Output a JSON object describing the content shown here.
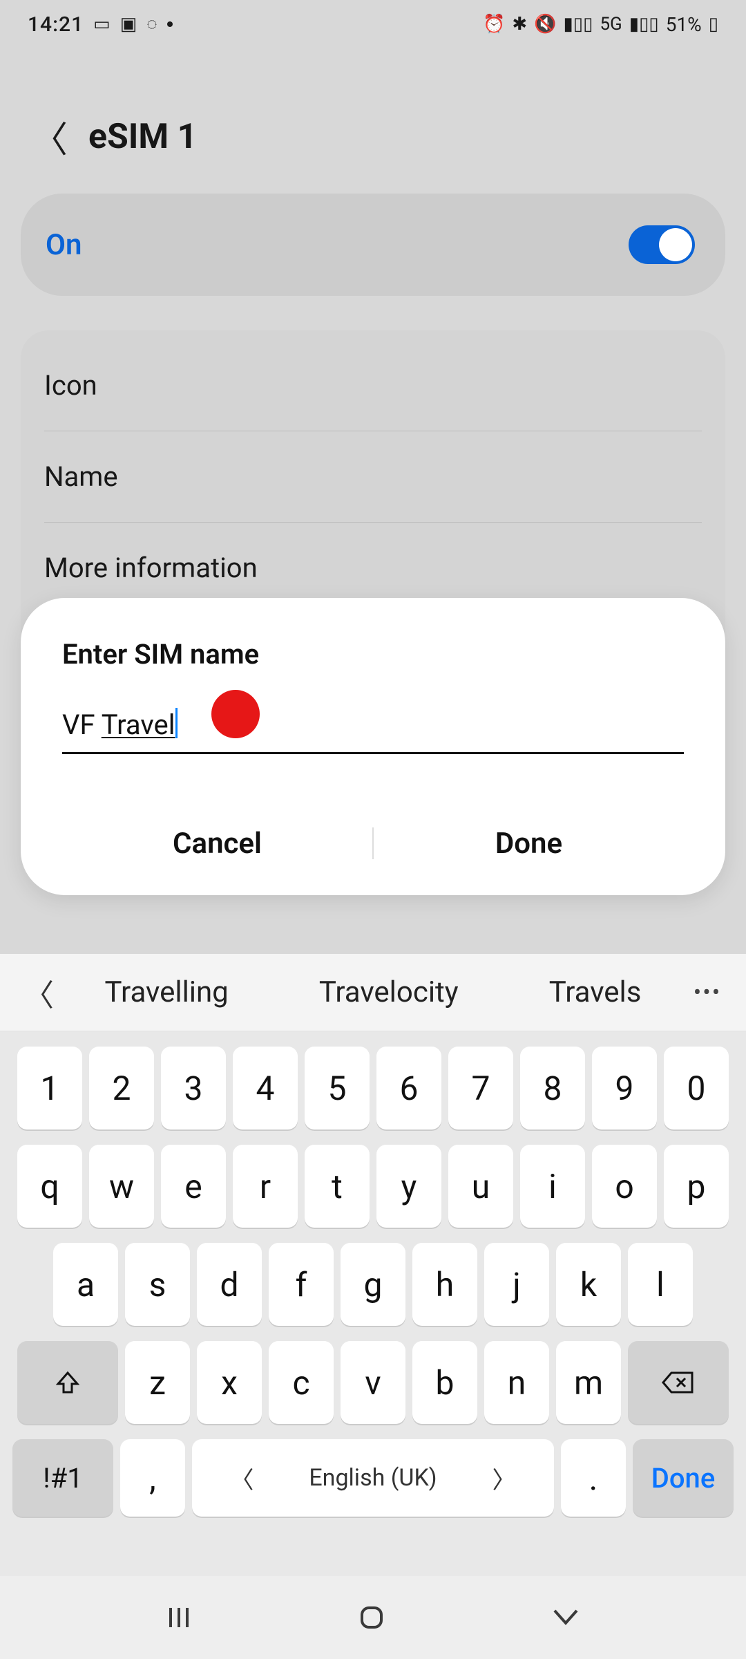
{
  "statusbar": {
    "time": "14:21",
    "battery": "51%"
  },
  "header": {
    "title": "eSIM 1"
  },
  "toggle": {
    "label": "On"
  },
  "list": {
    "icon": "Icon",
    "name": "Name",
    "more": "More information"
  },
  "dialog": {
    "title": "Enter SIM name",
    "input_prefix": "VF ",
    "input_underlined": "Travel",
    "cancel": "Cancel",
    "done": "Done"
  },
  "suggest": {
    "w1": "Travelling",
    "w2": "Travelocity",
    "w3": "Travels"
  },
  "kb": {
    "r1": [
      "1",
      "2",
      "3",
      "4",
      "5",
      "6",
      "7",
      "8",
      "9",
      "0"
    ],
    "r2": [
      "q",
      "w",
      "e",
      "r",
      "t",
      "y",
      "u",
      "i",
      "o",
      "p"
    ],
    "r3": [
      "a",
      "s",
      "d",
      "f",
      "g",
      "h",
      "j",
      "k",
      "l"
    ],
    "r4": [
      "z",
      "x",
      "c",
      "v",
      "b",
      "n",
      "m"
    ],
    "sym": "!#1",
    "comma": ",",
    "space_lang": "English (UK)",
    "period": ".",
    "done": "Done"
  }
}
